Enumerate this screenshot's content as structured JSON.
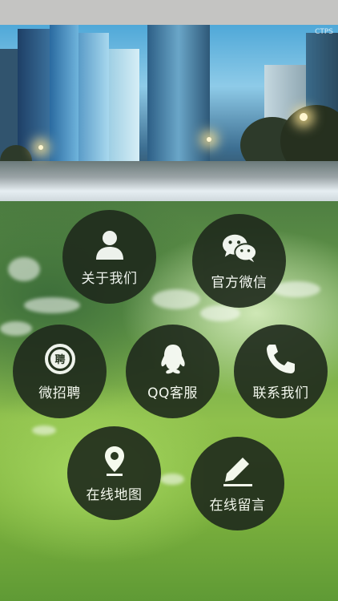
{
  "banner": {
    "watermark": "CTPS"
  },
  "menu": [
    {
      "label": "关于我们",
      "icon": "person-icon"
    },
    {
      "label": "官方微信",
      "icon": "wechat-icon"
    },
    {
      "label": "微招聘",
      "icon": "recruit-icon",
      "icon_text": "聘"
    },
    {
      "label": "QQ客服",
      "icon": "qq-icon"
    },
    {
      "label": "联系我们",
      "icon": "phone-icon"
    },
    {
      "label": "在线地图",
      "icon": "map-pin-icon"
    },
    {
      "label": "在线留言",
      "icon": "pencil-icon"
    }
  ],
  "colors": {
    "circle_bg": "#1f2a1c",
    "label": "#ffffff",
    "status_bar": "#c4c4c2"
  }
}
